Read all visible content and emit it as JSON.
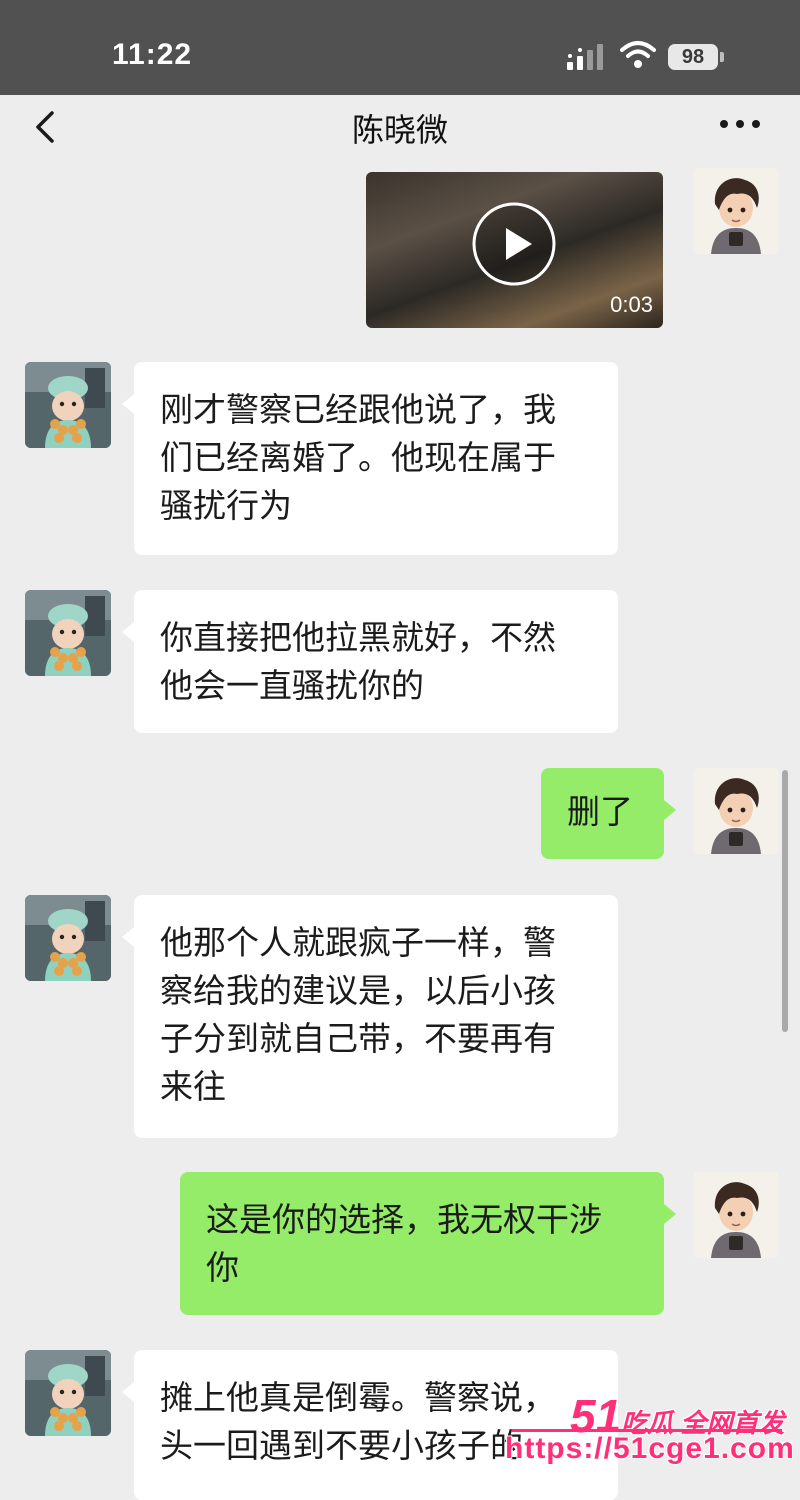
{
  "status_bar": {
    "time": "11:22",
    "battery": "98"
  },
  "header": {
    "title": "陈晓微",
    "back_icon": "chevron-left-icon",
    "more_icon": "more-icon"
  },
  "colors": {
    "self_bubble": "#95ec69",
    "other_bubble": "#ffffff",
    "background": "#ededed",
    "watermark": "#ff2f7a"
  },
  "messages": [
    {
      "sender": "self",
      "type": "video",
      "duration": "0:03"
    },
    {
      "sender": "other",
      "type": "text",
      "text": "刚才警察已经跟他说了，我\n们已经离婚了。他现在属于\n骚扰行为"
    },
    {
      "sender": "other",
      "type": "text",
      "text": "你直接把他拉黑就好，不然\n他会一直骚扰你的"
    },
    {
      "sender": "self",
      "type": "text",
      "text": "删了"
    },
    {
      "sender": "other",
      "type": "text",
      "text": "他那个人就跟疯子一样，警\n察给我的建议是，以后小孩\n子分到就自己带，不要再有\n来往"
    },
    {
      "sender": "self",
      "type": "text",
      "text": "这是你的选择，我无权干涉\n你"
    },
    {
      "sender": "other",
      "type": "text",
      "text": "摊上他真是倒霉。警察说，\n头一回遇到不要小孩子的"
    }
  ],
  "watermark": {
    "number": "51",
    "brand": "吃瓜 全网首发",
    "url": "https://51cge1.com"
  }
}
